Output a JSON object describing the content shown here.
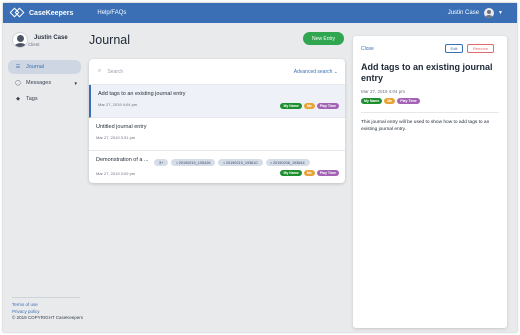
{
  "header": {
    "brand": "CaseKeepers",
    "help_link": "Help/FAQs",
    "user_name": "Justin Case"
  },
  "sidebar": {
    "profile_name": "Justin Case",
    "profile_role": "Client",
    "items": [
      {
        "label": "Journal",
        "icon": "list-icon",
        "active": true
      },
      {
        "label": "Messages",
        "icon": "chat-icon",
        "active": false
      },
      {
        "label": "Tags",
        "icon": "tag-icon",
        "active": false
      }
    ],
    "footer_links": [
      "Terms of use",
      "Privacy policy"
    ],
    "copyright": "© 2019 COPYRIGHT CaseKeepers"
  },
  "main": {
    "title": "Journal",
    "new_entry_label": "New Entry",
    "search_placeholder": "Search",
    "advanced_search": "Advanced search",
    "entries": [
      {
        "title": "Add tags to an existing journal entry",
        "date": "Mar 27, 2019 4:04 pm"
      },
      {
        "title": "Untitled journal entry",
        "date": "Mar 27, 2019 3:31 pm"
      },
      {
        "title": "Demonstration of a ...",
        "date": "Mar 27, 2019 3:09 pm",
        "attachments": [
          "3+",
          "20190219_105426",
          "20190219_193610",
          "20190208_193644"
        ]
      }
    ]
  },
  "tags": [
    {
      "label": "My Name",
      "color": "#1e8f2f"
    },
    {
      "label": "Me",
      "color": "#e8a23a"
    },
    {
      "label": "Play Time",
      "color": "#a362b5"
    }
  ],
  "detail": {
    "close_label": "Close",
    "edit_label": "Edit",
    "remove_label": "Remove",
    "title": "Add tags to an existing journal entry",
    "date": "Mar 27, 2019 4:04 pm",
    "body": "This journal entry will be used to show how to add tags to an existing journal entry."
  },
  "colors": {
    "primary": "#3a6fb5",
    "new_entry": "#2fa64f",
    "danger": "#e36a6a"
  }
}
